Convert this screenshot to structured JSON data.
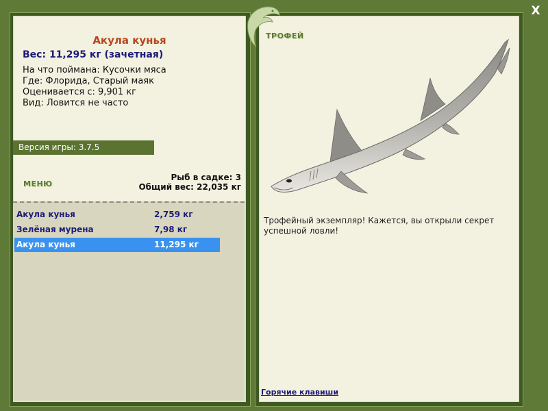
{
  "fish": {
    "title": "Акула кунья",
    "weight_line": "Вес: 11,295 кг (зачетная)",
    "bait_line": "На что поймана: Кусочки мяса",
    "location_line": "Где: Флорида, Старый маяк",
    "value_line": "Оценивается с: 9,901 кг",
    "rarity_line": "Вид: Ловится не часто"
  },
  "version_label": "Версия игры: 3.7.5",
  "menu_label": "МЕНЮ",
  "stats": {
    "count_line": "Рыб в садке: 3",
    "total_line": "Общий вес: 22,035 кг"
  },
  "catch": [
    {
      "name": "Акула кунья",
      "weight": "2,759 кг"
    },
    {
      "name": "Зелёная мурена",
      "weight": "7,98 кг"
    },
    {
      "name": "Акула кунья",
      "weight": "11,295 кг"
    }
  ],
  "trophy_label": "ТРОФЕЙ",
  "trophy_text": "Трофейный экземпляр! Кажется, вы открыли секрет успешной ловли!",
  "hotkeys_label": "Горячие клавиши",
  "close_label": "X",
  "colors": {
    "frame": "#5e7a36",
    "panel": "#f3f1e0",
    "accent_title": "#b8461c",
    "selected_row": "#3a92f0"
  }
}
